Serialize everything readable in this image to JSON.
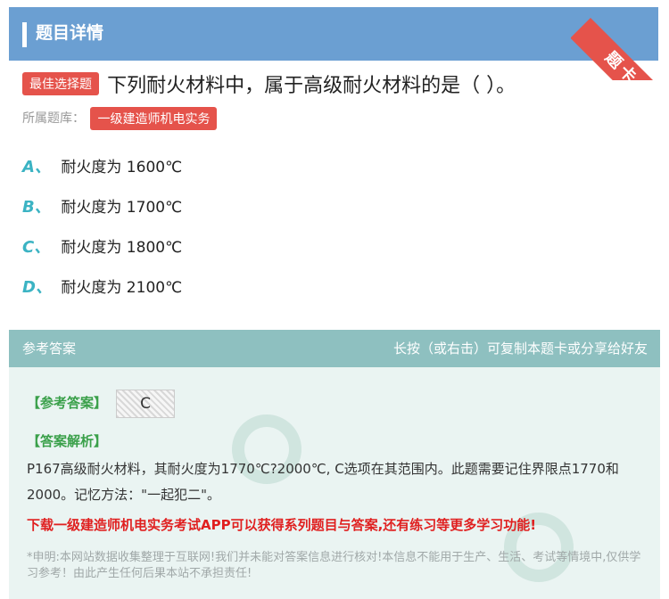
{
  "header": {
    "title": "题目详情",
    "corner_label": "题卡"
  },
  "question": {
    "tag": "最佳选择题",
    "text": "下列耐火材料中，属于高级耐火材料的是（    ）。",
    "library_label": "所属题库：",
    "library_name": "一级建造师机电实务",
    "options": [
      {
        "letter": "A、",
        "text": "耐火度为 1600℃"
      },
      {
        "letter": "B、",
        "text": "耐火度为 1700℃"
      },
      {
        "letter": "C、",
        "text": "耐火度为 1800℃"
      },
      {
        "letter": "D、",
        "text": "耐火度为 2100℃"
      }
    ]
  },
  "answer_panel": {
    "title": "参考答案",
    "hint": "长按（或右击）可复制本题卡或分享给好友",
    "answer_label": "【参考答案】",
    "answer_value": "C",
    "explanation_label": "【答案解析】",
    "explanation": "P167高级耐火材料，其耐火度为1770℃?2000℃, C选项在其范围内。此题需要记住界限点1770和2000。记忆方法：\"一起犯二\"。",
    "promo": "下载一级建造师机电实务考试APP可以获得系列题目与答案,还有练习等更多学习功能!",
    "disclaimer": "*申明:本网站数据收集整理于互联网!我们并未能对答案信息进行核对!本信息不能用于生产、生活、考试等情境中,仅供学习参考！由此产生任何后果本站不承担责任!"
  },
  "colors": {
    "header": "#6b9fd2",
    "tag": "#e5534b",
    "option_letter": "#3bb3c3",
    "answer_green": "#3aa04a",
    "promo_red": "#e02020"
  }
}
